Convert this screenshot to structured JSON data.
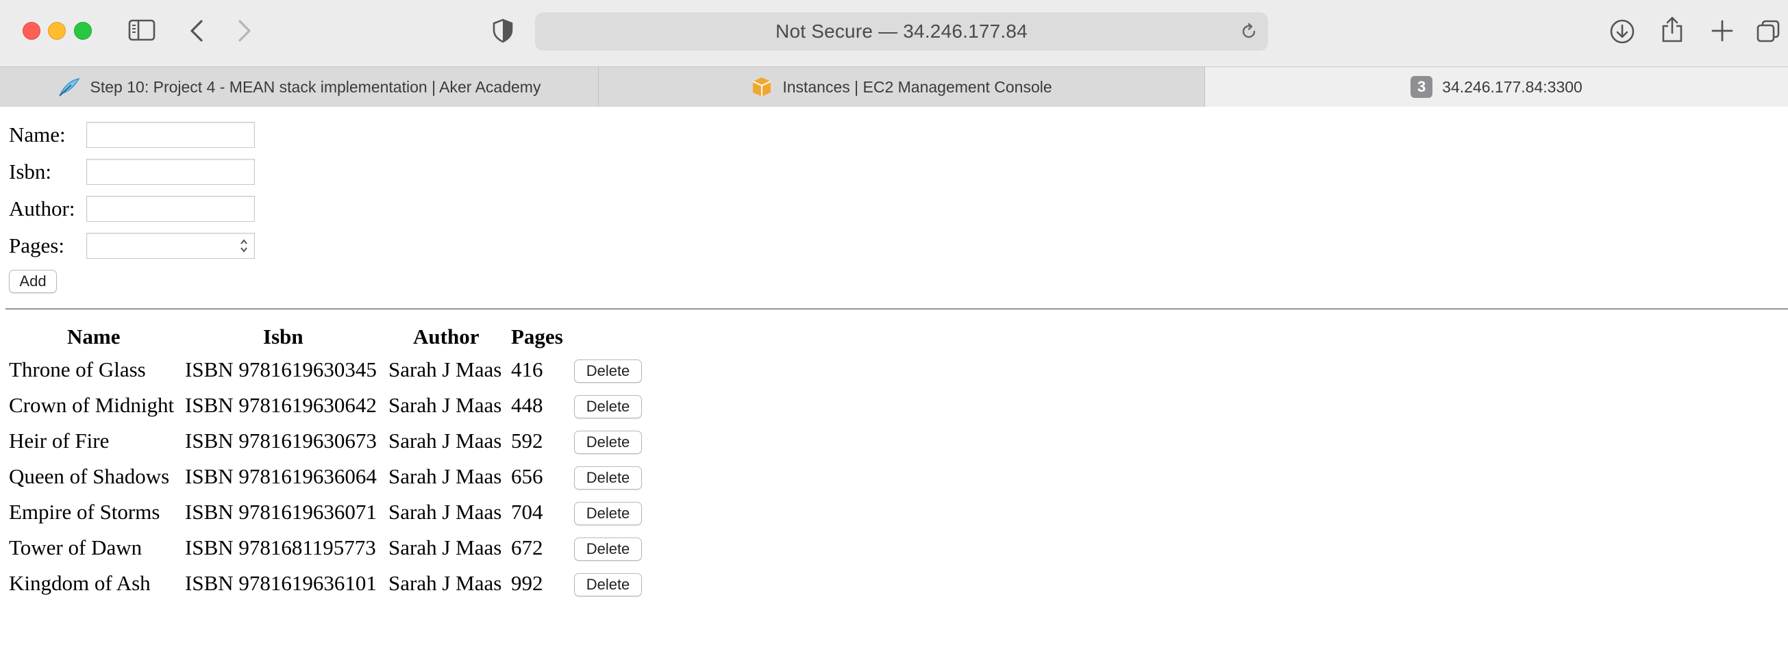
{
  "browser": {
    "address": "Not Secure — 34.246.177.84",
    "tabs": [
      {
        "label": "Step 10: Project 4 - MEAN stack implementation | Aker Academy",
        "favicon": "feather-icon"
      },
      {
        "label": "Instances | EC2 Management Console",
        "favicon": "aws-box-icon"
      },
      {
        "label": "34.246.177.84:3300",
        "favicon": "3",
        "active": true
      }
    ]
  },
  "form": {
    "fields": [
      {
        "label": "Name:",
        "value": ""
      },
      {
        "label": "Isbn:",
        "value": ""
      },
      {
        "label": "Author:",
        "value": ""
      },
      {
        "label": "Pages:",
        "value": ""
      }
    ],
    "add_label": "Add"
  },
  "table": {
    "headers": [
      "Name",
      "Isbn",
      "Author",
      "Pages"
    ],
    "delete_label": "Delete",
    "rows": [
      {
        "name": "Throne of Glass",
        "isbn": "ISBN 9781619630345",
        "author": "Sarah J Maas",
        "pages": "416"
      },
      {
        "name": "Crown of Midnight",
        "isbn": "ISBN 9781619630642",
        "author": "Sarah J Maas",
        "pages": "448"
      },
      {
        "name": "Heir of Fire",
        "isbn": "ISBN 9781619630673",
        "author": "Sarah J Maas",
        "pages": "592"
      },
      {
        "name": "Queen of Shadows",
        "isbn": "ISBN 9781619636064",
        "author": "Sarah J Maas",
        "pages": "656"
      },
      {
        "name": "Empire of Storms",
        "isbn": "ISBN 9781619636071",
        "author": "Sarah J Maas",
        "pages": "704"
      },
      {
        "name": "Tower of Dawn",
        "isbn": "ISBN 9781681195773",
        "author": "Sarah J Maas",
        "pages": "672"
      },
      {
        "name": "Kingdom of Ash",
        "isbn": "ISBN 9781619636101",
        "author": "Sarah J Maas",
        "pages": "992"
      }
    ]
  }
}
